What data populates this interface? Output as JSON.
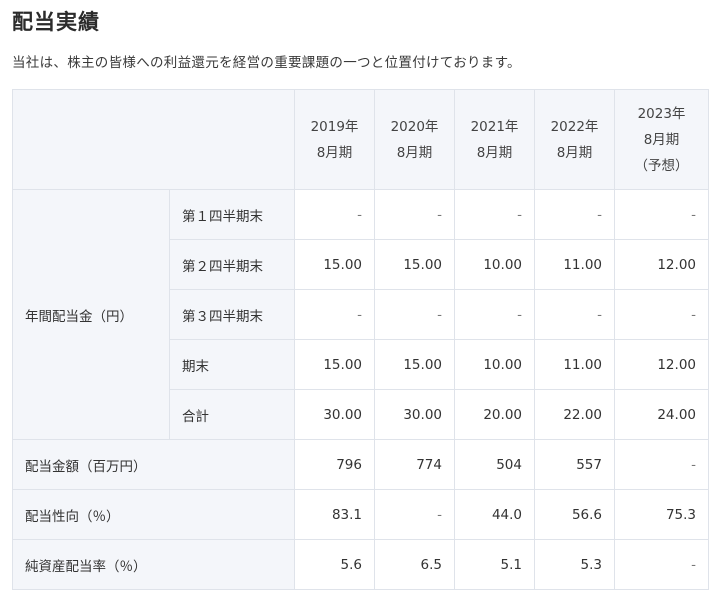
{
  "page": {
    "title": "配当実績",
    "lead": "当社は、株主の皆様への利益還元を経営の重要課題の一つと位置付けております。"
  },
  "table": {
    "years": [
      {
        "line1": "2019年",
        "line2": "8月期",
        "line3": ""
      },
      {
        "line1": "2020年",
        "line2": "8月期",
        "line3": ""
      },
      {
        "line1": "2021年",
        "line2": "8月期",
        "line3": ""
      },
      {
        "line1": "2022年",
        "line2": "8月期",
        "line3": ""
      },
      {
        "line1": "2023年",
        "line2": "8月期",
        "line3": "（予想）"
      }
    ],
    "annual_dividend": {
      "label": "年間配当金（円）",
      "rows": [
        {
          "label": "第１四半期末",
          "values": [
            "-",
            "-",
            "-",
            "-",
            "-"
          ]
        },
        {
          "label": "第２四半期末",
          "values": [
            "15.00",
            "15.00",
            "10.00",
            "11.00",
            "12.00"
          ]
        },
        {
          "label": "第３四半期末",
          "values": [
            "-",
            "-",
            "-",
            "-",
            "-"
          ]
        },
        {
          "label": "期末",
          "values": [
            "15.00",
            "15.00",
            "10.00",
            "11.00",
            "12.00"
          ]
        },
        {
          "label": "合計",
          "values": [
            "30.00",
            "30.00",
            "20.00",
            "22.00",
            "24.00"
          ]
        }
      ]
    },
    "other_rows": [
      {
        "label": "配当金額（百万円）",
        "values": [
          "796",
          "774",
          "504",
          "557",
          "-"
        ]
      },
      {
        "label": "配当性向（％）",
        "values": [
          "83.1",
          "-",
          "44.0",
          "56.6",
          "75.3"
        ]
      },
      {
        "label": "純資産配当率（％）",
        "values": [
          "5.6",
          "6.5",
          "5.1",
          "5.3",
          "-"
        ]
      }
    ]
  }
}
